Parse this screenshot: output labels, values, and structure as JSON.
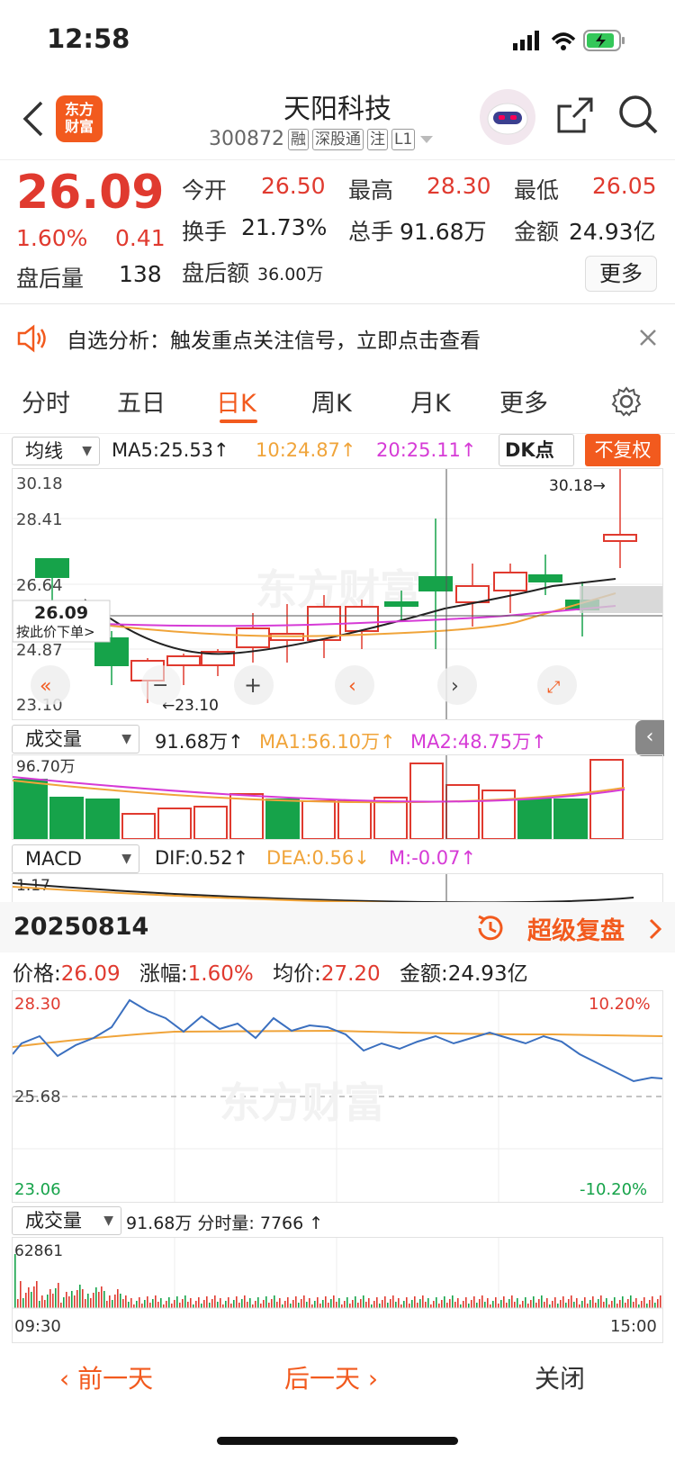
{
  "status_bar": {
    "time": "12:58"
  },
  "header": {
    "logo_text_line1": "东方",
    "logo_text_line2": "财富",
    "stock_name": "天阳科技",
    "stock_code": "300872",
    "tags": [
      "融",
      "深股通",
      "注",
      "L1"
    ]
  },
  "quote": {
    "price": "26.09",
    "change_pct": "1.60%",
    "change": "0.41",
    "after_hours_vol_label": "盘后量",
    "after_hours_vol": "138",
    "open_label": "今开",
    "open": "26.50",
    "high_label": "最高",
    "high": "28.30",
    "low_label": "最低",
    "low": "26.05",
    "turnover_label": "换手",
    "turnover": "21.73%",
    "total_hands_label": "总手",
    "total_hands": "91.68万",
    "amount_label": "金额",
    "amount": "24.93亿",
    "after_hours_amt_label": "盘后额",
    "after_hours_amt": "36.00万",
    "more_button": "更多"
  },
  "notice": {
    "text": "自选分析：触发重点关注信号，立即点击查看"
  },
  "tabs": [
    "分时",
    "五日",
    "日K",
    "周K",
    "月K",
    "更多"
  ],
  "active_tab": "日K",
  "ma_row": {
    "selector": "均线",
    "ma5": "MA5:25.53↑",
    "ma10": "10:24.87↑",
    "ma20": "20:25.11↑",
    "dk_button": "DK点",
    "fq_button": "不复权"
  },
  "kline": {
    "y_labels": [
      "30.18",
      "28.41",
      "26.64",
      "24.87",
      "23.10"
    ],
    "max_annot": "30.18→",
    "min_annot": "←23.10",
    "crosshair_price": "26.09",
    "crosshair_hint": "按此价下单>",
    "watermark": "东方财富"
  },
  "volume_row": {
    "selector": "成交量",
    "vol": "91.68万↑",
    "ma1": "MA1:56.10万↑",
    "ma2": "MA2:48.75万↑",
    "top_label": "96.70万"
  },
  "macd_row": {
    "selector": "MACD",
    "dif": "DIF:0.52↑",
    "dea": "DEA:0.56↓",
    "m": "M:-0.07↑",
    "top_label": "1.17"
  },
  "replay": {
    "date": "20250814",
    "button": "超级复盘",
    "price_label": "价格:",
    "price": "26.09",
    "chg_label": "涨幅:",
    "chg": "1.60%",
    "avg_label": "均价:",
    "avg": "27.20",
    "amt_label": "金额:",
    "amt": "24.93亿"
  },
  "intraday": {
    "top_left": "28.30",
    "mid_left": "25.68",
    "bottom_left": "23.06",
    "top_right": "10.20%",
    "bottom_right": "-10.20%",
    "watermark": "东方财富"
  },
  "intraday_volume": {
    "selector": "成交量",
    "text": "91.68万 分时量: 7766 ↑",
    "top_label": "62861",
    "start_time": "09:30",
    "end_time": "15:00"
  },
  "footer": {
    "prev": "前一天",
    "next": "后一天",
    "close": "关闭"
  },
  "colors": {
    "accent": "#f25a1e",
    "up": "#e03a2f",
    "down": "#16a34a",
    "ma10": "#f0a43a",
    "ma20": "#d63bd6"
  }
}
